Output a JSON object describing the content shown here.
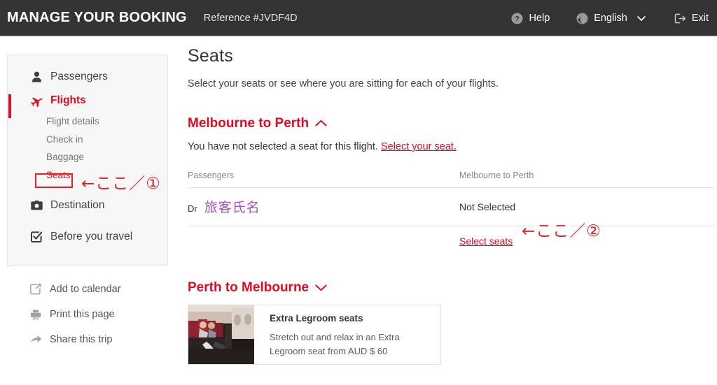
{
  "header": {
    "brand_title": "MANAGE YOUR BOOKING",
    "reference": "Reference #JVDF4D",
    "help_label": "Help",
    "language_label": "English",
    "exit_label": "Exit",
    "background": "#333333"
  },
  "sidebar": {
    "items": [
      {
        "label": "Passengers",
        "icon": "person-icon",
        "active": false
      },
      {
        "label": "Flights",
        "icon": "airplane-icon",
        "active": true
      },
      {
        "label": "Destination",
        "icon": "camera-icon",
        "active": false
      },
      {
        "label": "Before you travel",
        "icon": "checklist-icon",
        "active": false
      }
    ],
    "sub_items": [
      {
        "label": "Flight details",
        "highlight": false
      },
      {
        "label": "Check in",
        "highlight": false
      },
      {
        "label": "Baggage",
        "highlight": false
      },
      {
        "label": "Seats",
        "highlight": true
      }
    ],
    "extra_links": [
      {
        "label": "Add to calendar",
        "icon": "calendar-icon"
      },
      {
        "label": "Print this page",
        "icon": "printer-icon"
      },
      {
        "label": "Share this trip",
        "icon": "share-arrow-icon"
      }
    ]
  },
  "main": {
    "title": "Seats",
    "subtitle": "Select your seats or see where you are sitting for each of your flights.",
    "flight_outbound": {
      "heading": "Melbourne to Perth",
      "expanded": true,
      "note_text": "You have not selected a seat for this flight.",
      "note_link": "Select your seat.",
      "columns": [
        "Passengers",
        "Melbourne to Perth"
      ],
      "rows": [
        {
          "title": "Dr",
          "name": "旅客氏名",
          "seat": "Not Selected"
        }
      ],
      "select_seats_link": "Select seats"
    },
    "flight_return": {
      "heading": "Perth to Melbourne",
      "expanded": false
    }
  },
  "promo": {
    "title": "Extra Legroom seats",
    "description": "Stretch out and relax in an Extra Legroom seat from AUD $ 60"
  },
  "annotations": [
    {
      "id": "annotation-1",
      "text": "←ここ／①",
      "color": "#ee1c25"
    },
    {
      "id": "annotation-2",
      "text": "←ここ／②",
      "color": "#ee1c25"
    }
  ],
  "colors": {
    "brand_red": "#e40b20",
    "annotation_red": "#ee1c25",
    "passenger_name": "#a74fbe",
    "header_bg": "#333333"
  }
}
